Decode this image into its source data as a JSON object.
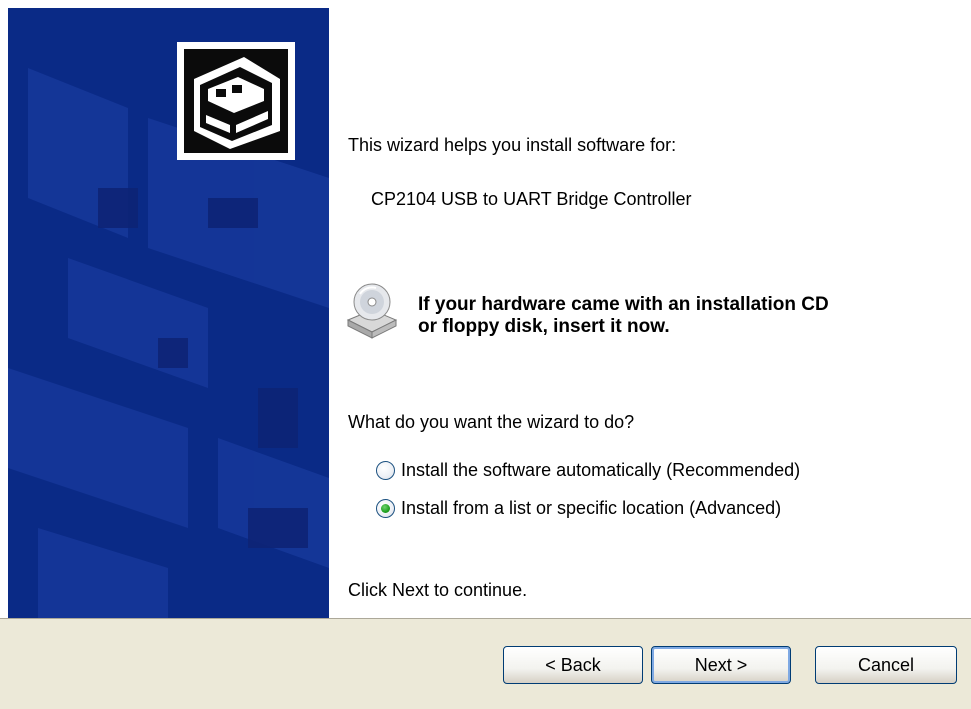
{
  "wizard": {
    "intro_text": "This wizard helps you install software for:",
    "device_name": "CP2104 USB to UART Bridge Controller",
    "cd_message_line1": "If your hardware came with an installation CD",
    "cd_message_line2": "or floppy disk, insert it now.",
    "question": "What do you want the wizard to do?",
    "options": [
      {
        "label": "Install the software automatically (Recommended)",
        "selected": false
      },
      {
        "label": "Install from a list or specific location (Advanced)",
        "selected": true
      }
    ],
    "continue_text": "Click Next to continue."
  },
  "buttons": {
    "back": "< Back",
    "next": "Next >",
    "cancel": "Cancel"
  },
  "icons": {
    "banner": "hardware-card-icon",
    "cd": "cd-drive-icon"
  },
  "colors": {
    "banner_blue": "#0a2a86",
    "bottom_bar": "#ece9d8",
    "radio_selected": "#21a121"
  }
}
